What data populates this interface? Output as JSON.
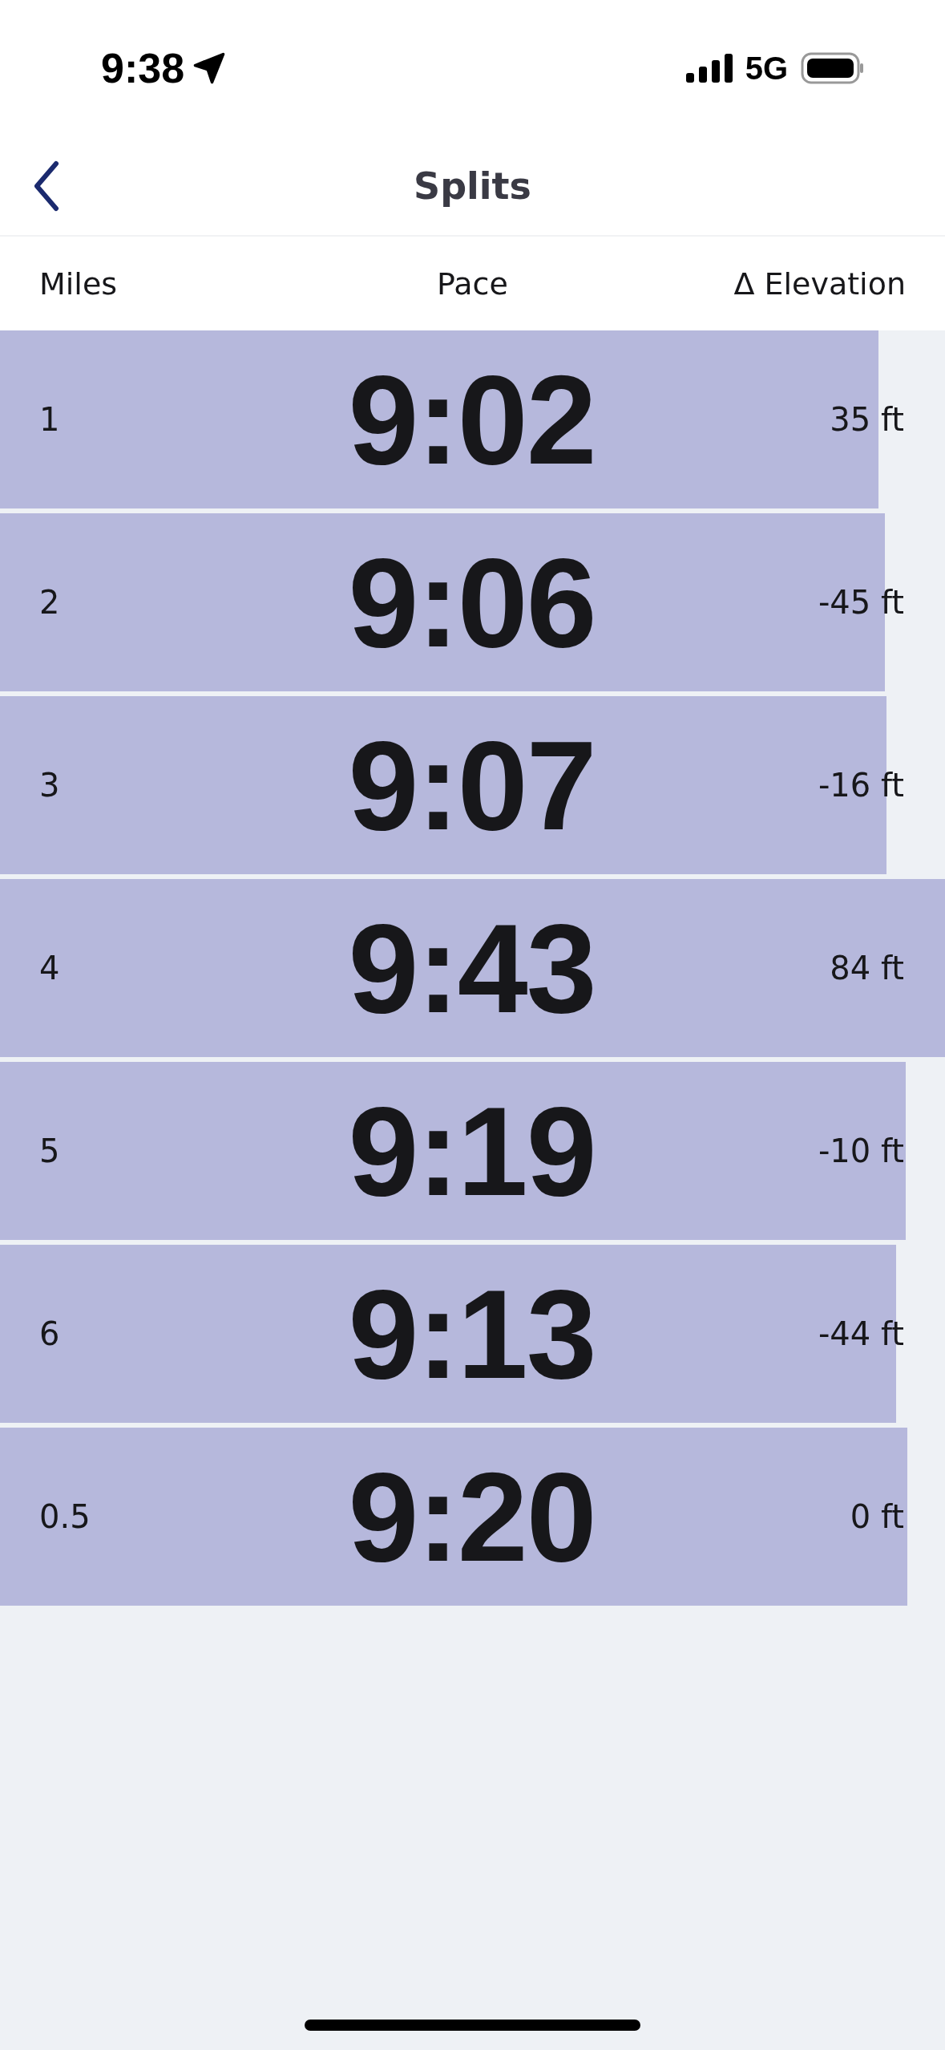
{
  "status_bar": {
    "time": "9:38",
    "network": "5G"
  },
  "nav": {
    "title": "Splits"
  },
  "columns": [
    "Miles",
    "Pace",
    "Δ Elevation"
  ],
  "splits": [
    {
      "mile": "1",
      "pace": "9:02",
      "elevation": "35 ft"
    },
    {
      "mile": "2",
      "pace": "9:06",
      "elevation": "-45 ft"
    },
    {
      "mile": "3",
      "pace": "9:07",
      "elevation": "-16 ft"
    },
    {
      "mile": "4",
      "pace": "9:43",
      "elevation": "84 ft"
    },
    {
      "mile": "5",
      "pace": "9:19",
      "elevation": "-10 ft"
    },
    {
      "mile": "6",
      "pace": "9:13",
      "elevation": "-44 ft"
    },
    {
      "mile": "0.5",
      "pace": "9:20",
      "elevation": "0 ft"
    }
  ]
}
